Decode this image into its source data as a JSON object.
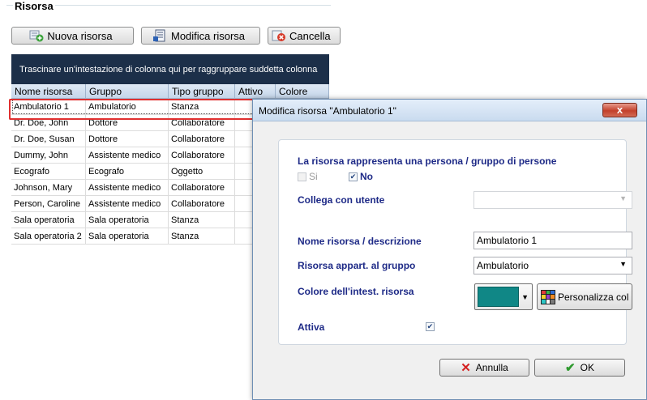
{
  "section_title": "Risorsa",
  "toolbar": {
    "new_label": "Nuova risorsa",
    "edit_label": "Modifica risorsa",
    "delete_label": "Cancella"
  },
  "grid": {
    "group_hint": "Trascinare un'intestazione di colonna qui per raggruppare suddetta colonna",
    "columns": [
      "Nome risorsa",
      "Gruppo",
      "Tipo gruppo",
      "Attivo",
      "Colore"
    ],
    "rows": [
      {
        "name": "Ambulatorio 1",
        "group": "Ambulatorio",
        "type": "Stanza"
      },
      {
        "name": "Dr. Doe, John",
        "group": "Dottore",
        "type": "Collaboratore"
      },
      {
        "name": "Dr. Doe, Susan",
        "group": "Dottore",
        "type": "Collaboratore"
      },
      {
        "name": "Dummy, John",
        "group": "Assistente medico",
        "type": "Collaboratore"
      },
      {
        "name": "Ecografo",
        "group": "Ecografo",
        "type": "Oggetto"
      },
      {
        "name": "Johnson, Mary",
        "group": "Assistente medico",
        "type": "Collaboratore"
      },
      {
        "name": "Person, Caroline",
        "group": "Assistente medico",
        "type": "Collaboratore"
      },
      {
        "name": "Sala operatoria",
        "group": "Sala operatoria",
        "type": "Stanza"
      },
      {
        "name": "Sala operatoria 2",
        "group": "Sala operatoria",
        "type": "Stanza"
      }
    ]
  },
  "dialog": {
    "title": "Modifica risorsa \"Ambulatorio 1\"",
    "close_glyph": "x",
    "person_question": "La risorsa rappresenta una persona / gruppo di persone",
    "yes_label": "Si",
    "no_label": "No",
    "link_user_label": "Collega con utente",
    "link_user_value": "",
    "name_label": "Nome risorsa / descrizione",
    "name_value": "Ambulatorio 1",
    "group_label": "Risorsa appart. al gruppo",
    "group_value": "Ambulatorio",
    "color_label": "Colore dell'intest. risorsa",
    "color_value": "#108786",
    "customize_label": "Personalizza col",
    "active_label": "Attiva",
    "cancel_label": "Annulla",
    "ok_label": "OK"
  },
  "colors": {
    "label_blue": "#1e2a87",
    "grid_band": "#1c2f49",
    "selection_red": "#e03030"
  }
}
